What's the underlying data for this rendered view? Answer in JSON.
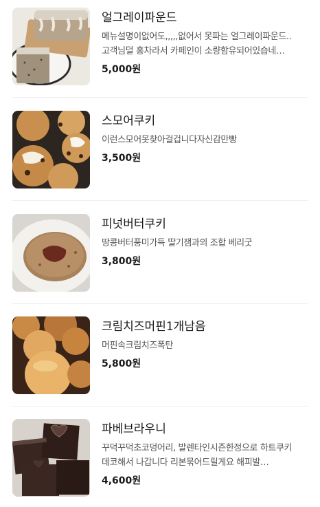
{
  "menu": {
    "items": [
      {
        "name": "얼그레이파운드",
        "description": "메뉴설명이없어도,,,,,없어서 못파는 얼그레이파운드.. 고객님덜 홍차라서 카페인이 소량함유되어있습네…",
        "price": "5,000원",
        "image": "earl-grey-pound-cake-photo"
      },
      {
        "name": "스모어쿠키",
        "description": "이런스모어못찾아걸겁니다자신감만빵",
        "price": "3,500원",
        "image": "smore-cookie-photo"
      },
      {
        "name": "피넛버터쿠키",
        "description": "땅콩버터풍미가득 딸기잼과의 조합 베리굿",
        "price": "3,800원",
        "image": "peanut-butter-cookie-photo"
      },
      {
        "name": "크림치즈머핀1개남음",
        "description": "머핀속크림치즈폭탄",
        "price": "5,800원",
        "image": "cream-cheese-muffin-photo"
      },
      {
        "name": "파베브라우니",
        "description": "꾸덕꾸덕초코덩어리, 발렌타인시즌한정으로 하트쿠키 데코해서 나갑니다 리본묶어드릴게요 해피발…",
        "price": "4,600원",
        "image": "pave-brownie-photo"
      }
    ]
  }
}
